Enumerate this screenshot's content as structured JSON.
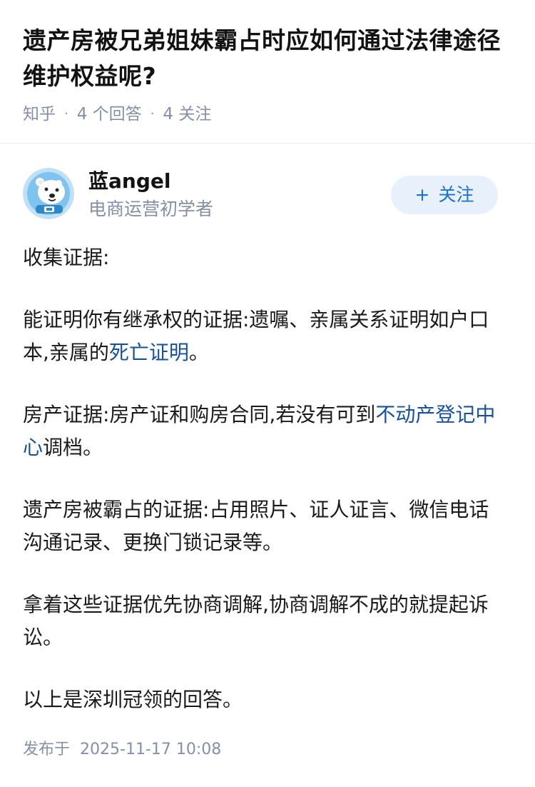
{
  "question": {
    "title": "遗产房被兄弟姐妹霸占时应如何通过法律途径维护权益呢?",
    "source": "知乎",
    "answers": "4 个回答",
    "follows": "4 关注",
    "separator": "·"
  },
  "author": {
    "name": "蓝angel",
    "description": "电商运营初学者",
    "avatar_icon": "polar-bear-avatar",
    "follow_plus": "+",
    "follow_label": "关注"
  },
  "answer": {
    "p1": "收集证据:",
    "p2_text": "能证明你有继承权的证据:遗嘱、亲属关系证明如户口本,亲属的",
    "p2_link": "死亡证明",
    "p2_end": "。",
    "p3_text": "房产证据:房产证和购房合同,若没有可到",
    "p3_link": "不动产登记中心",
    "p3_end": "调档。",
    "p4": "遗产房被霸占的证据:占用照片、证人证言、微信电话沟通记录、更换门锁记录等。",
    "p5": "拿着这些证据优先协商调解,协商调解不成的就提起诉讼。",
    "p6": "以上是深圳冠领的回答。"
  },
  "footer": {
    "published_label": "发布于",
    "published_date": "2025-11-17 10:08"
  },
  "colors": {
    "link": "#175199",
    "follow_text": "#1772d1",
    "follow_bg": "#e8f1fb",
    "meta": "#8590a6"
  }
}
